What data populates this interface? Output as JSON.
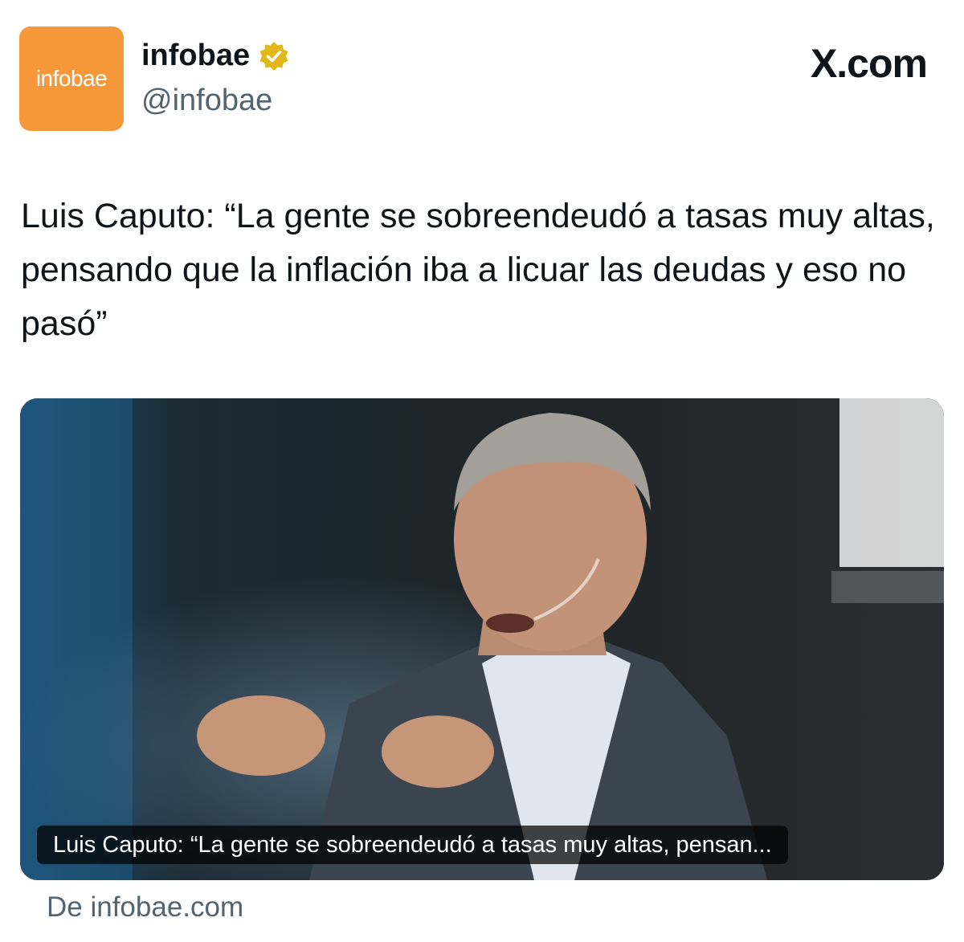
{
  "profile": {
    "avatar_text": "infobae",
    "display_name": "infobae",
    "handle": "@infobae",
    "brand_color": "#f6973a",
    "verified_color": "#e2b719"
  },
  "header": {
    "platform_logo": "X.com"
  },
  "tweet": {
    "text": "Luis Caputo: “La gente se sobreendeudó a tasas muy altas, pensando que la inflación iba a licuar las deudas y eso no pasó”"
  },
  "link_card": {
    "caption": "Luis Caputo: “La gente se sobreendeudó a tasas muy altas, pensan...",
    "source": "De infobae.com"
  }
}
